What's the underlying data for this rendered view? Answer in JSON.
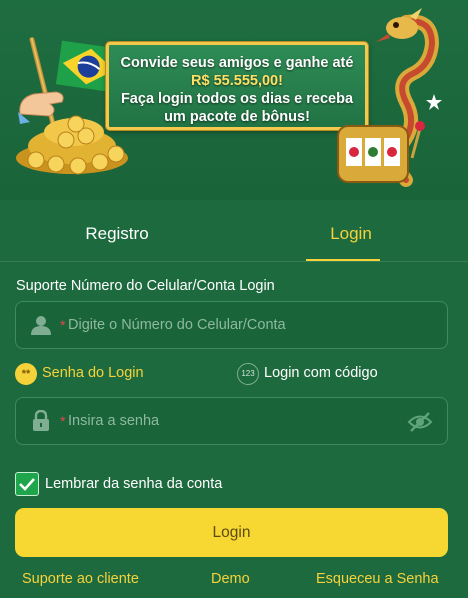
{
  "banner": {
    "line1": "Convide seus amigos e ganhe até",
    "amount": "R$ 55.555,00!",
    "line3": "Faça login todos os dias e receba",
    "line4": "um pacote de bônus!"
  },
  "tabs": [
    {
      "label": "Registro",
      "active": false
    },
    {
      "label": "Login",
      "active": true
    }
  ],
  "form": {
    "account_label": "Suporte Número do Celular/Conta Login",
    "account_placeholder": "Digite o Número do Celular/Conta",
    "password_placeholder": "Insira a senha",
    "required_mark": "*",
    "methods": [
      {
        "label": "Senha do Login",
        "icon": "password-dots-icon",
        "active": true
      },
      {
        "label": "Login com código",
        "icon": "code-123-icon",
        "active": false
      }
    ],
    "code_icon_text": "123",
    "pwd_icon_text": "**",
    "remember_label": "Lembrar da senha da conta",
    "remember_checked": true,
    "login_button": "Login"
  },
  "footer": {
    "support": "Suporte ao cliente",
    "demo": "Demo",
    "forgot": "Esqueceu a Senha"
  },
  "colors": {
    "background": "#1d6a3f",
    "accent": "#f6d23a",
    "button": "#f7d732",
    "checkbox": "#1fa54b",
    "required": "#e5484d"
  }
}
